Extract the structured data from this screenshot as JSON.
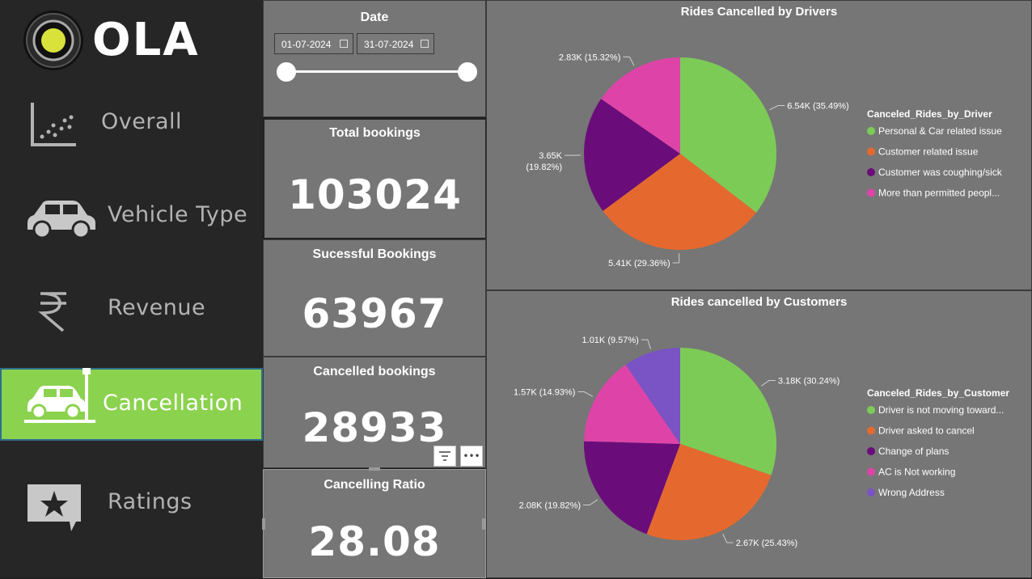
{
  "brand": {
    "name": "OLA"
  },
  "nav": {
    "overall": "Overall",
    "vehicle_type": "Vehicle Type",
    "revenue": "Revenue",
    "cancellation": "Cancellation",
    "ratings": "Ratings"
  },
  "date_filter": {
    "title": "Date",
    "start": "01-07-2024",
    "end": "31-07-2024"
  },
  "kpis": {
    "total_bookings": {
      "label": "Total bookings",
      "value": "103024"
    },
    "successful_bookings": {
      "label": "Sucessful Bookings",
      "value": "63967"
    },
    "cancelled_bookings": {
      "label": "Cancelled bookings",
      "value": "28933"
    },
    "cancelling_ratio": {
      "label": "Cancelling Ratio",
      "value": "28.08"
    }
  },
  "colors": {
    "green": "#7dcb57",
    "orange": "#e5692f",
    "purple": "#6a0d7a",
    "pink": "#de44a8",
    "violet": "#7a53c4",
    "active_nav": "#8bd24e"
  },
  "chart_data": [
    {
      "type": "pie",
      "title": "Rides Cancelled by Drivers",
      "legend_title": "Canceled_Rides_by_Driver",
      "legend_position": "right",
      "categories": [
        "Personal & Car related issue",
        "Customer related issue",
        "Customer was coughing/sick",
        "More than permitted peopl..."
      ],
      "values": [
        6.54,
        5.41,
        3.65,
        2.83
      ],
      "percent": [
        35.49,
        29.36,
        19.82,
        15.32
      ],
      "labels": [
        "6.54K (35.49%)",
        "5.41K (29.36%)",
        "3.65K",
        "2.83K (15.32%)"
      ],
      "label_extra": [
        "",
        "",
        "(19.82%)",
        ""
      ],
      "colors": [
        "#7dcb57",
        "#e5692f",
        "#6a0d7a",
        "#de44a8"
      ]
    },
    {
      "type": "pie",
      "title": "Rides cancelled by Customers",
      "legend_title": "Canceled_Rides_by_Customer",
      "legend_position": "right",
      "categories": [
        "Driver is not moving toward...",
        "Driver asked to cancel",
        "Change of plans",
        "AC is Not working",
        "Wrong Address"
      ],
      "values": [
        3.18,
        2.67,
        2.08,
        1.57,
        1.01
      ],
      "percent": [
        30.24,
        25.43,
        19.82,
        14.93,
        9.57
      ],
      "labels": [
        "3.18K (30.24%)",
        "2.67K (25.43%)",
        "2.08K (19.82%)",
        "1.57K (14.93%)",
        "1.01K (9.57%)"
      ],
      "colors": [
        "#7dcb57",
        "#e5692f",
        "#6a0d7a",
        "#de44a8",
        "#7a53c4"
      ]
    }
  ]
}
